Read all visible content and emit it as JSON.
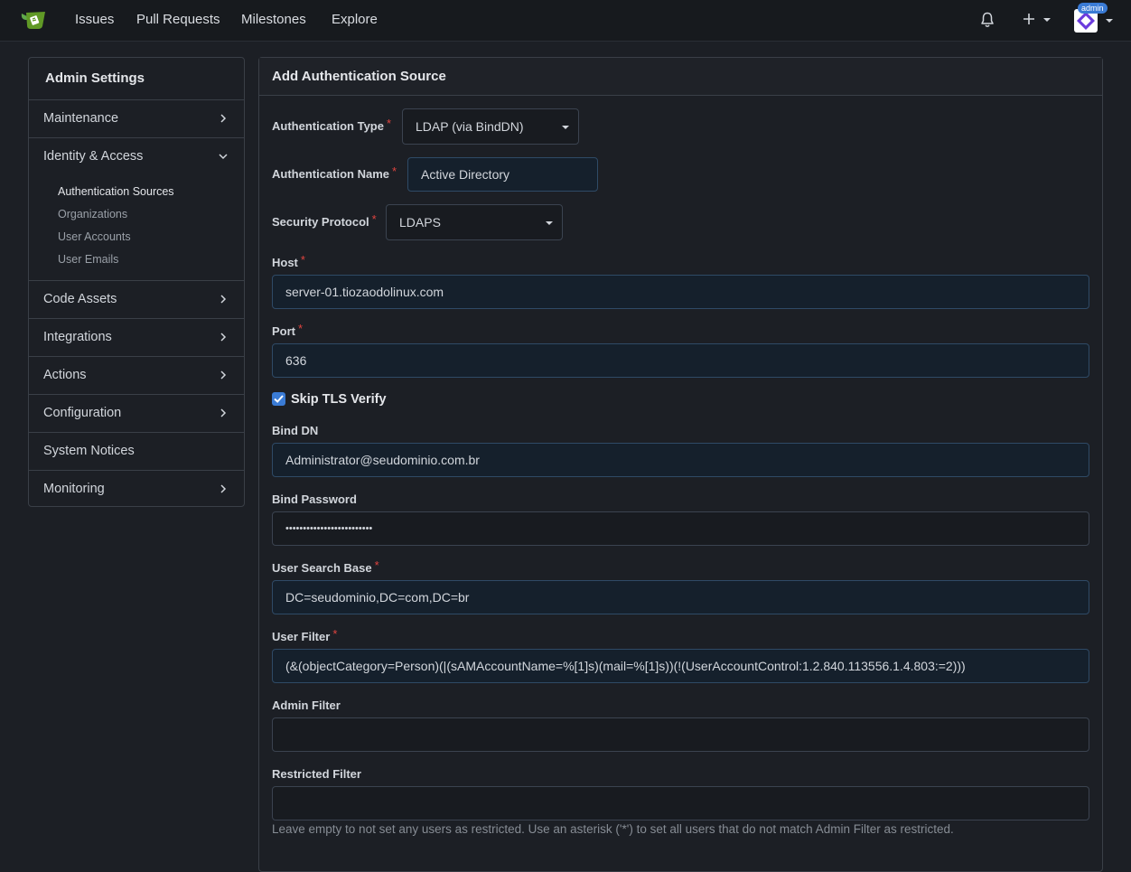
{
  "nav": {
    "links": [
      "Issues",
      "Pull Requests",
      "Milestones",
      "Explore"
    ],
    "admin_badge": "admin",
    "icons": [
      "gitea-logo-icon",
      "bell-icon",
      "plus-icon",
      "avatar"
    ]
  },
  "sidebar": {
    "title": "Admin Settings",
    "items": [
      {
        "label": "Maintenance",
        "expandable": true
      },
      {
        "label": "Identity & Access",
        "expanded": true,
        "children": [
          "Authentication Sources",
          "Organizations",
          "User Accounts",
          "User Emails"
        ],
        "active_child": "Authentication Sources"
      },
      {
        "label": "Code Assets",
        "expandable": true
      },
      {
        "label": "Integrations",
        "expandable": true
      },
      {
        "label": "Actions",
        "expandable": true
      },
      {
        "label": "Configuration",
        "expandable": true
      },
      {
        "label": "System Notices",
        "expandable": false
      },
      {
        "label": "Monitoring",
        "expandable": true
      }
    ]
  },
  "form": {
    "title": "Add Authentication Source",
    "auth_type": {
      "label": "Authentication Type",
      "value": "LDAP (via BindDN)"
    },
    "auth_name": {
      "label": "Authentication Name",
      "value": "Active Directory"
    },
    "security_protocol": {
      "label": "Security Protocol",
      "value": "LDAPS"
    },
    "host": {
      "label": "Host",
      "value": "server-01.tiozaodolinux.com"
    },
    "port": {
      "label": "Port",
      "value": "636"
    },
    "skip_tls": {
      "label": "Skip TLS Verify",
      "checked": true
    },
    "bind_dn": {
      "label": "Bind DN",
      "value": "Administrator@seudominio.com.br"
    },
    "bind_password": {
      "label": "Bind Password",
      "value": "•••••••••••••••••••••••••"
    },
    "user_search_base": {
      "label": "User Search Base",
      "value": "DC=seudominio,DC=com,DC=br"
    },
    "user_filter": {
      "label": "User Filter",
      "value": "(&(objectCategory=Person)(|(sAMAccountName=%[1]s)(mail=%[1]s))(!(UserAccountControl:1.2.840.113556.1.4.803:=2)))"
    },
    "admin_filter": {
      "label": "Admin Filter",
      "value": ""
    },
    "restricted_filter": {
      "label": "Restricted Filter",
      "value": "",
      "hint": "Leave empty to not set any users as restricted. Use an asterisk ('*') to set all users that do not match Admin Filter as restricted."
    }
  },
  "colors": {
    "accent": "#3a7bd5",
    "required": "#e0443f",
    "background": "#1c1f25"
  }
}
